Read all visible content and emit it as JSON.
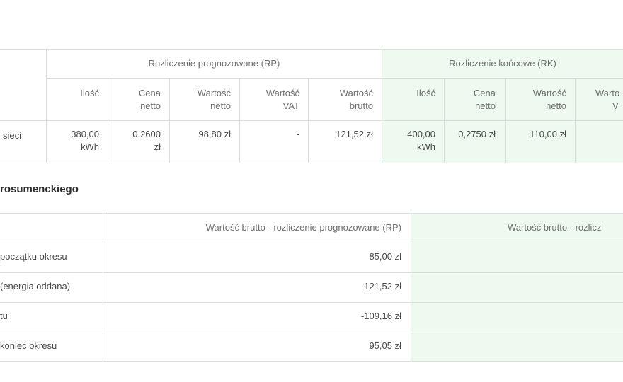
{
  "table1": {
    "group_rp": "Rozliczenie prognozowane (RP)",
    "group_rk": "Rozliczenie końcowe (RK)",
    "columns": [
      {
        "l1": "Ilość",
        "l2": ""
      },
      {
        "l1": "Cena",
        "l2": "netto"
      },
      {
        "l1": "Wartość",
        "l2": "netto"
      },
      {
        "l1": "Wartość",
        "l2": "VAT"
      },
      {
        "l1": "Wartość",
        "l2": "brutto"
      },
      {
        "l1": "Ilość",
        "l2": ""
      },
      {
        "l1": "Cena",
        "l2": "netto"
      },
      {
        "l1": "Wartość",
        "l2": "netto"
      },
      {
        "l1": "Warto",
        "l2": "V"
      }
    ],
    "row": {
      "label": "sieci",
      "cells": [
        {
          "l1": "380,00",
          "l2": "kWh"
        },
        {
          "l1": "0,2600",
          "l2": "zł"
        },
        {
          "l1": "98,80 zł",
          "l2": ""
        },
        {
          "l1": "-",
          "l2": ""
        },
        {
          "l1": "121,52 zł",
          "l2": ""
        },
        {
          "l1": "400,00",
          "l2": "kWh"
        },
        {
          "l1": "0,2750 zł",
          "l2": ""
        },
        {
          "l1": "110,00 zł",
          "l2": ""
        },
        {
          "l1": "",
          "l2": ""
        }
      ]
    }
  },
  "section_title": "rosumenckiego",
  "table2": {
    "header_rp": "Wartość brutto - rozliczenie prognozowane (RP)",
    "header_rk": "Wartość brutto - rozlicz",
    "rows": [
      {
        "label": "początku okresu",
        "value": "85,00 zł"
      },
      {
        "label": "(energia oddana)",
        "value": "121,52 zł"
      },
      {
        "label": "tu",
        "value": "-109,16 zł"
      },
      {
        "label": "koniec okresu",
        "value": "95,05 zł"
      }
    ]
  },
  "colors": {
    "green_bg": "#eefaef",
    "border": "#dcdcdc"
  }
}
